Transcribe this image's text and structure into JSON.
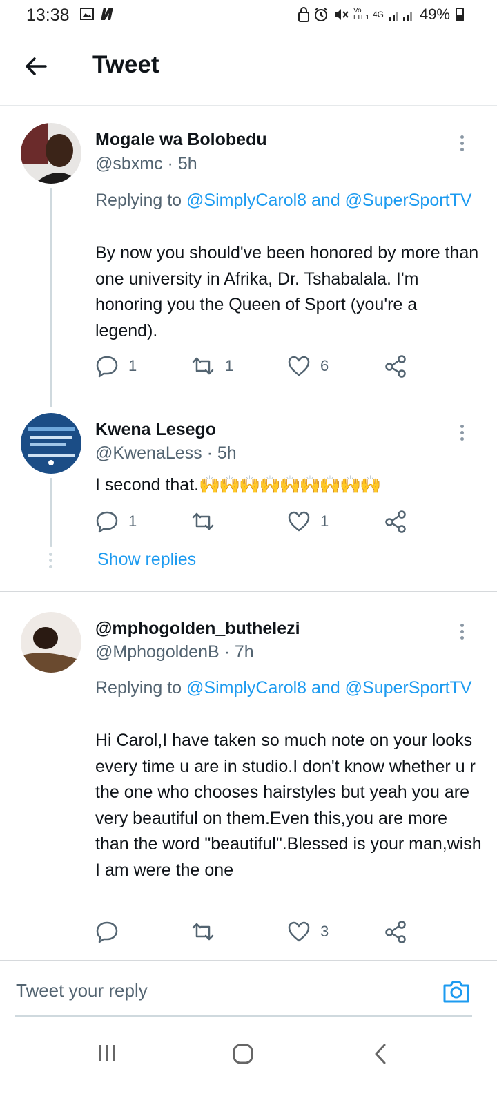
{
  "status_bar": {
    "time": "13:38",
    "battery": "49%",
    "network_label": "4G",
    "volte_label": "Vo LTE1"
  },
  "header": {
    "title": "Tweet"
  },
  "tweets": [
    {
      "name": "Mogale wa Bolobedu",
      "handle": "@sbxmc · 5h",
      "replying_prefix": "Replying to",
      "replying_mentions": "@SimplyCarol8 and @SuperSportTV",
      "text": "By now you should've been honored by more than one university in Afrika, Dr. Tshabalala. I'm honoring you the Queen of Sport (you're a legend).",
      "replies": "1",
      "retweets": "1",
      "likes": "6"
    },
    {
      "name": "Kwena Lesego",
      "handle": "@KwenaLess · 5h",
      "text": "I second that.",
      "emojis": "🙌🙌🙌🙌🙌🙌🙌🙌🙌",
      "replies": "1",
      "retweets": "",
      "likes": "1"
    },
    {
      "name": "@mphogolden_buthelezi",
      "handle": "@MphogoldenB · 7h",
      "replying_prefix": "Replying to",
      "replying_mentions": "@SimplyCarol8 and @SuperSportTV",
      "text": "Hi Carol,I have taken so much note on your looks every time u are in studio.I don't know whether u r the one who chooses hairstyles but yeah you are very beautiful on them.Even this,you are more than the word \"beautiful\".Blessed is your man,wish I am were the one",
      "replies": "",
      "retweets": "",
      "likes": "3"
    }
  ],
  "show_replies_label": "Show replies",
  "reply_bar": {
    "placeholder": "Tweet your reply"
  },
  "colors": {
    "accent": "#1d9bf0",
    "text": "#0f1419",
    "secondary": "#536471",
    "thread": "#cfd9de"
  }
}
